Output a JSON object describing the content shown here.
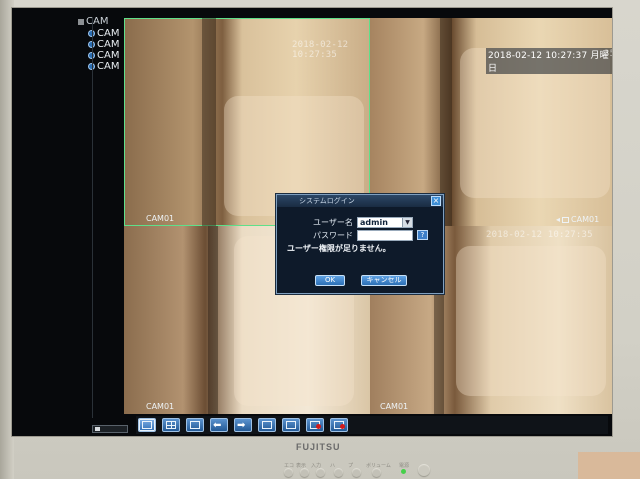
{
  "camera_list": {
    "header": "CAM",
    "items": [
      "CAM",
      "CAM",
      "CAM",
      "CAM"
    ]
  },
  "tiles": [
    {
      "timestamp": "2018-02-12 10:27:35",
      "label": "CAM01"
    },
    {
      "timestamp": "2018-02-12 10:27:37 月曜日",
      "label": "CAM01"
    },
    {
      "timestamp": "",
      "label": "CAM01"
    },
    {
      "timestamp": "2018-02-12 10:27:35",
      "label": "CAM01"
    }
  ],
  "tile2_corner": "35",
  "dialog": {
    "title": "システムログイン",
    "close": "×",
    "username_label": "ユーザー名",
    "username_value": "admin",
    "password_label": "パスワード",
    "password_value": "",
    "keyboard_button": "?",
    "message": "ユーザー権限が足りません。",
    "ok_label": "OK",
    "cancel_label": "キャンセル"
  },
  "toolbar": {
    "buttons": [
      "single-view-icon",
      "quad-view-icon",
      "fullscreen-icon",
      "previous-arrow-icon",
      "next-arrow-icon",
      "playback-icon",
      "search-icon",
      "record-icon",
      "record-stop-icon"
    ]
  },
  "bezel": {
    "brand": "FUJITSU",
    "control_labels": [
      "エコ",
      "表示",
      "入力",
      "ハ",
      "プ",
      "ボリューム",
      "電源"
    ]
  },
  "colors": {
    "screen_bg": "#07090c",
    "dialog_bg": "#0e1a2a",
    "button_blue": "#3e7fc8",
    "active_tile_border": "#5fe08a",
    "power_led": "#46d04a"
  }
}
